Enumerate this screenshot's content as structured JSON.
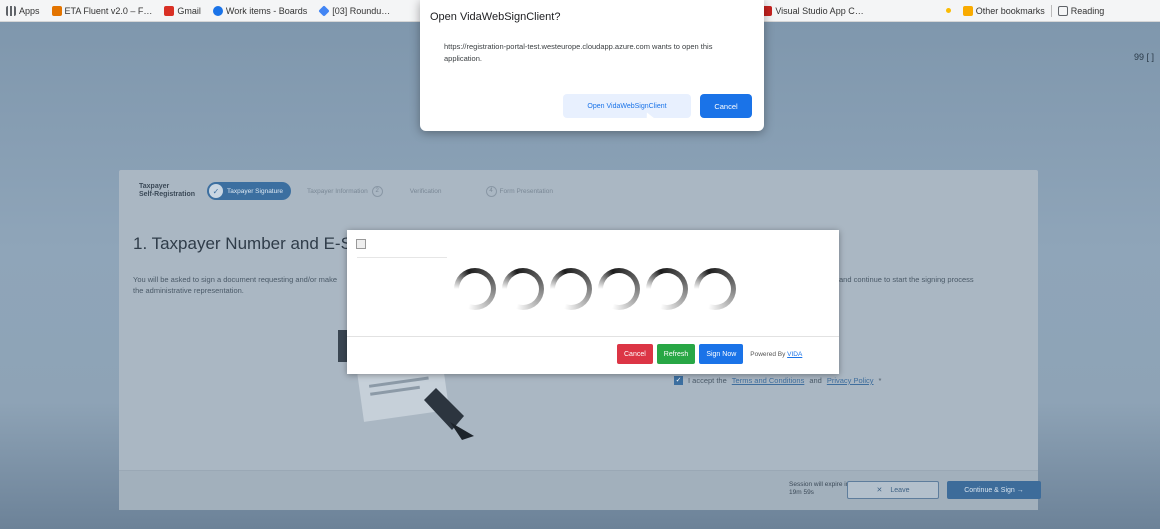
{
  "bookmarks": {
    "items": [
      {
        "label": "Apps",
        "color": "#5f6368"
      },
      {
        "label": "ETA Fluent v2.0 – F…",
        "color": "#e37400"
      },
      {
        "label": "Gmail",
        "color": "#d93025"
      },
      {
        "label": "Work items - Boards",
        "color": "#1a73e8"
      },
      {
        "label": "[03] Roundu…",
        "color": "#4285f4"
      },
      {
        "label": "Visual Studio App C…",
        "color": "#c5221f"
      },
      {
        "label": "",
        "color": "#fbbc04"
      },
      {
        "label": "Other bookmarks",
        "color": "#f9ab00"
      },
      {
        "label": "Reading",
        "color": "#5f6368"
      }
    ]
  },
  "page": {
    "top_right": "99 [ ]"
  },
  "card": {
    "brand_line1": "Taxpayer",
    "brand_line2": "Self-Registration",
    "steps": [
      {
        "label": "Taxpayer Signature",
        "num": ""
      },
      {
        "label": "Taxpayer Information",
        "num": "2"
      },
      {
        "label": "Verification",
        "num": "3"
      },
      {
        "label": "Form Presentation",
        "num": "4"
      }
    ],
    "title": "1. Taxpayer Number and E-Sign",
    "text_left": "You will be asked to sign a document requesting and/or make the administrative representation.",
    "text_right": "and continue to start the signing process",
    "terms_prefix": "I accept the",
    "terms_link1": "Terms and Conditions",
    "terms_and": "and",
    "terms_link2": "Privacy Policy",
    "terms_suffix": "*",
    "session_line1": "Session will expire in",
    "session_line2": "19m 59s",
    "leave_button": "Leave",
    "continue_button": "Continue & Sign →"
  },
  "sign_modal": {
    "cancel": "Cancel",
    "refresh": "Refresh",
    "sign_now": "Sign Now",
    "powered_by": "Powered By",
    "vendor": "VIDA"
  },
  "dialog": {
    "title": "Open VidaWebSignClient?",
    "body": "https://registration-portal-test.westeurope.cloudapp.azure.com wants to open this application.",
    "open_button": "Open VidaWebSignClient",
    "cancel_button": "Cancel"
  },
  "colors": {
    "accent": "#1a73e8",
    "danger": "#dc3545",
    "success": "#28a745"
  }
}
